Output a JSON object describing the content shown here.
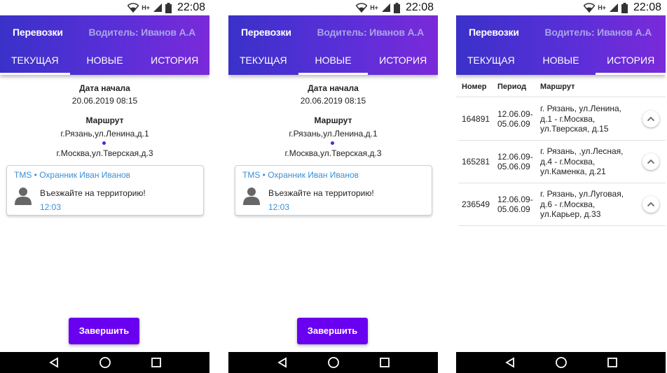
{
  "status": {
    "time": "22:08",
    "network": "H+"
  },
  "appbar": {
    "title": "Перевозки",
    "driver": "Водитель: Иванов А.А"
  },
  "tabs": [
    "ТЕКУЩАЯ",
    "НОВЫЕ",
    "ИСТОРИЯ"
  ],
  "trip": {
    "start_label": "Дата начала",
    "start_value": "20.06.2019 08:15",
    "route_label": "Маршрут",
    "from": "г.Рязань,ул.Ленина,д.1",
    "to": "г.Москва,ул.Тверская,д.3"
  },
  "message": {
    "header": "TMS • Охранник Иван Иванов",
    "text": "Въезжайте на территорию!",
    "time": "12:03"
  },
  "finish_button": "Завершить",
  "history": {
    "columns": [
      "Номер",
      "Период",
      "Маршрут"
    ],
    "rows": [
      {
        "number": "164891",
        "period_from": "12.06.09-",
        "period_to": "05.06.09",
        "route": [
          "г. Рязань, ул.Ленина,",
          "д.1 - г.Москва,",
          "ул.Тверская, д.15"
        ]
      },
      {
        "number": "165281",
        "period_from": "12.06.09-",
        "period_to": "05.06.09",
        "route": [
          "г. Рязань, ,ул.Лесная,",
          "д.4 - г.Москва,",
          "ул.Каменка, д.21"
        ]
      },
      {
        "number": "236549",
        "period_from": "12.06.09-",
        "period_to": "05.06.09",
        "route": [
          "г. Рязань, ул.Луговая,",
          "д.6 - г.Москва,",
          "ул.Карьер, д.33"
        ]
      }
    ]
  },
  "colors": {
    "accent": "#6a00f0",
    "gradient_start": "#3a31c9",
    "gradient_end": "#7a2ad9",
    "link": "#3a8fd6"
  },
  "icons": [
    "wifi-icon",
    "h-plus-icon",
    "signal-icon",
    "battery-icon",
    "person-icon",
    "chevron-up-icon",
    "back-icon",
    "home-icon",
    "recents-icon"
  ]
}
